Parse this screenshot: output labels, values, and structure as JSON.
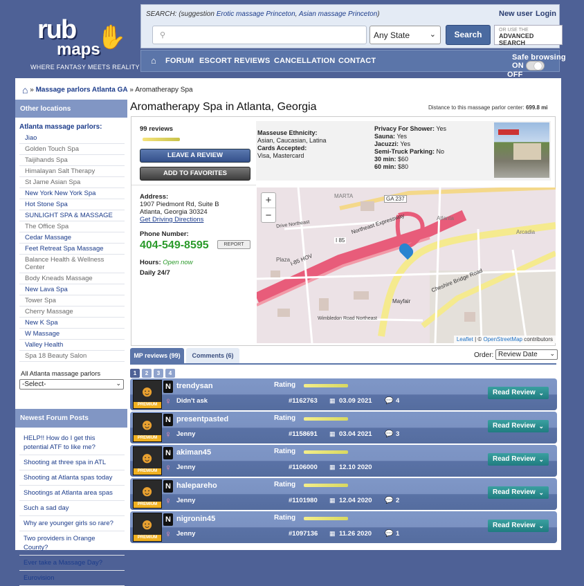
{
  "header": {
    "logo_line1": "rub",
    "logo_line2": "maps",
    "tagline": "WHERE FANTASY MEETS REALITY",
    "search_label": "SEARCH: (suggestion ",
    "suggestion1": "Erotic massage Princeton",
    "suggestion_sep": ", ",
    "suggestion2": "Asian massage Princeton",
    "suggestion_end": ")",
    "new_user": "New user",
    "login": "Login",
    "search_value": "",
    "state_select": "Any State",
    "search_button": "Search",
    "adv_line1": "OR USE THE",
    "adv_line2": "ADVANCED SEARCH",
    "nav": [
      "FORUM",
      "ESCORT REVIEWS",
      "CANCELLATION",
      "CONTACT"
    ],
    "safe_browsing": "Safe browsing",
    "safe_on": "ON",
    "safe_off": "OFF"
  },
  "breadcrumb": {
    "link": "Massage parlors Atlanta GA",
    "sep": "»",
    "current": "Aromatherapy Spa"
  },
  "sidebar": {
    "other_locations": "Other locations",
    "parlors_title": "Atlanta massage parlors:",
    "parlors": [
      {
        "name": "Jiao",
        "c": "bl"
      },
      {
        "name": "Golden Touch Spa",
        "c": "gr"
      },
      {
        "name": "Taijihands Spa",
        "c": "gr"
      },
      {
        "name": "Himalayan Salt Therapy",
        "c": "gr"
      },
      {
        "name": "St Jame Asian Spa",
        "c": "gr"
      },
      {
        "name": "New York New York Spa",
        "c": "bl"
      },
      {
        "name": "Hot Stone Spa",
        "c": "bl"
      },
      {
        "name": "SUNLIGHT SPA & MASSAGE",
        "c": "bl"
      },
      {
        "name": "The Office Spa",
        "c": "gr"
      },
      {
        "name": "Cedar Massage",
        "c": "bl"
      },
      {
        "name": "Feet Retreat Spa Massage",
        "c": "bl"
      },
      {
        "name": "Balance Health & Wellness Center",
        "c": "gr"
      },
      {
        "name": "Body Kneads Massage",
        "c": "gr"
      },
      {
        "name": "New Lava Spa",
        "c": "bl"
      },
      {
        "name": "Tower Spa",
        "c": "gr"
      },
      {
        "name": "Cherry Massage",
        "c": "gr"
      },
      {
        "name": "New K Spa",
        "c": "bl"
      },
      {
        "name": "W Massage",
        "c": "bl"
      },
      {
        "name": "Valley Health",
        "c": "bl"
      },
      {
        "name": "Spa 18 Beauty Salon",
        "c": "gr"
      }
    ],
    "all_label": "All Atlanta massage parlors",
    "all_select": "-Select-",
    "forum_title": "Newest Forum Posts",
    "forum_posts": [
      "HELP!! How do I get this potential ATF to like me?",
      "Shooting at three spa in ATL",
      "Shooting at Atlanta spas today",
      "Shootings at Atlanta area spas",
      "Such a sad day",
      "Why are younger girls so rare?",
      "Two providers in Orange County?",
      "Ever take a Massage Day?",
      "Eurovision"
    ]
  },
  "main": {
    "title": "Aromatherapy Spa in Atlanta, Georgia",
    "distance_label": "Distance to this massage parlor center: ",
    "distance_value": "699.8 mi",
    "review_count": "99 reviews",
    "leave_review": "LEAVE A REVIEW",
    "add_favorites": "ADD TO FAVORITES",
    "ethnicity_label": "Masseuse Ethnicity:",
    "ethnicity": "Asian, Caucasian, Latina",
    "cards_label": "Cards Accepted:",
    "cards": "Visa, Mastercard",
    "shower_label": "Privacy For Shower:",
    "shower": "Yes",
    "sauna_label": "Sauna:",
    "sauna": "Yes",
    "jacuzzi_label": "Jacuzzi:",
    "jacuzzi": "Yes",
    "parking_label": "Semi-Truck Parking:",
    "parking": "No",
    "p30_label": "30 min:",
    "p30": "$60",
    "p60_label": "60 min:",
    "p60": "$80",
    "address_label": "Address:",
    "address1": "1907 Piedmont Rd, Suite B",
    "address2": "Atlanta, Georgia 30324",
    "directions": "Get Driving Directions",
    "phone_label": "Phone Number:",
    "phone": "404-549-8595",
    "report": "REPORT",
    "hours_label": "Hours:",
    "hours_status": "Open now",
    "daily": "Daily  24/7"
  },
  "map": {
    "labels": [
      "MARTA",
      "GA 237",
      "Plaza",
      "Atlanta",
      "I 85",
      "I-85 HOV",
      "Northeast Expressway",
      "Cheshire Bridge Road",
      "Mayfair",
      "Wimbledon Road Northeast",
      "Drive Northeast",
      "Arcadia"
    ],
    "zoom_in": "+",
    "zoom_out": "−",
    "leaflet": "Leaflet",
    "osm_sep": " | © ",
    "osm": "OpenStreetMap",
    "contributors": " contributors"
  },
  "tabs": {
    "mp_reviews": "MP reviews (99)",
    "comments": "Comments (6)",
    "order_label": "Order:",
    "order_value": "Review Date",
    "pages": [
      "1",
      "2",
      "3",
      "4"
    ]
  },
  "reviews": [
    {
      "user": "trendysan",
      "girl": "Didn't ask",
      "id": "#1162763",
      "date": "03.09 2021",
      "comments": "4",
      "rating_label": "Rating",
      "read": "Read Review"
    },
    {
      "user": "presentpasted",
      "girl": "Jenny",
      "id": "#1158691",
      "date": "03.04 2021",
      "comments": "3",
      "rating_label": "Rating",
      "read": "Read Review"
    },
    {
      "user": "akiman45",
      "girl": "Jenny",
      "id": "#1106000",
      "date": "12.10 2020",
      "comments": "",
      "rating_label": "Rating",
      "read": "Read Review"
    },
    {
      "user": "halepareho",
      "girl": "Jenny",
      "id": "#1101980",
      "date": "12.04 2020",
      "comments": "2",
      "rating_label": "Rating",
      "read": "Read Review"
    },
    {
      "user": "nigronin45",
      "girl": "Jenny",
      "id": "#1097136",
      "date": "11.26 2020",
      "comments": "1",
      "rating_label": "Rating",
      "read": "Read Review"
    }
  ],
  "premium_label": "PREMIUM",
  "n_badge": "N"
}
